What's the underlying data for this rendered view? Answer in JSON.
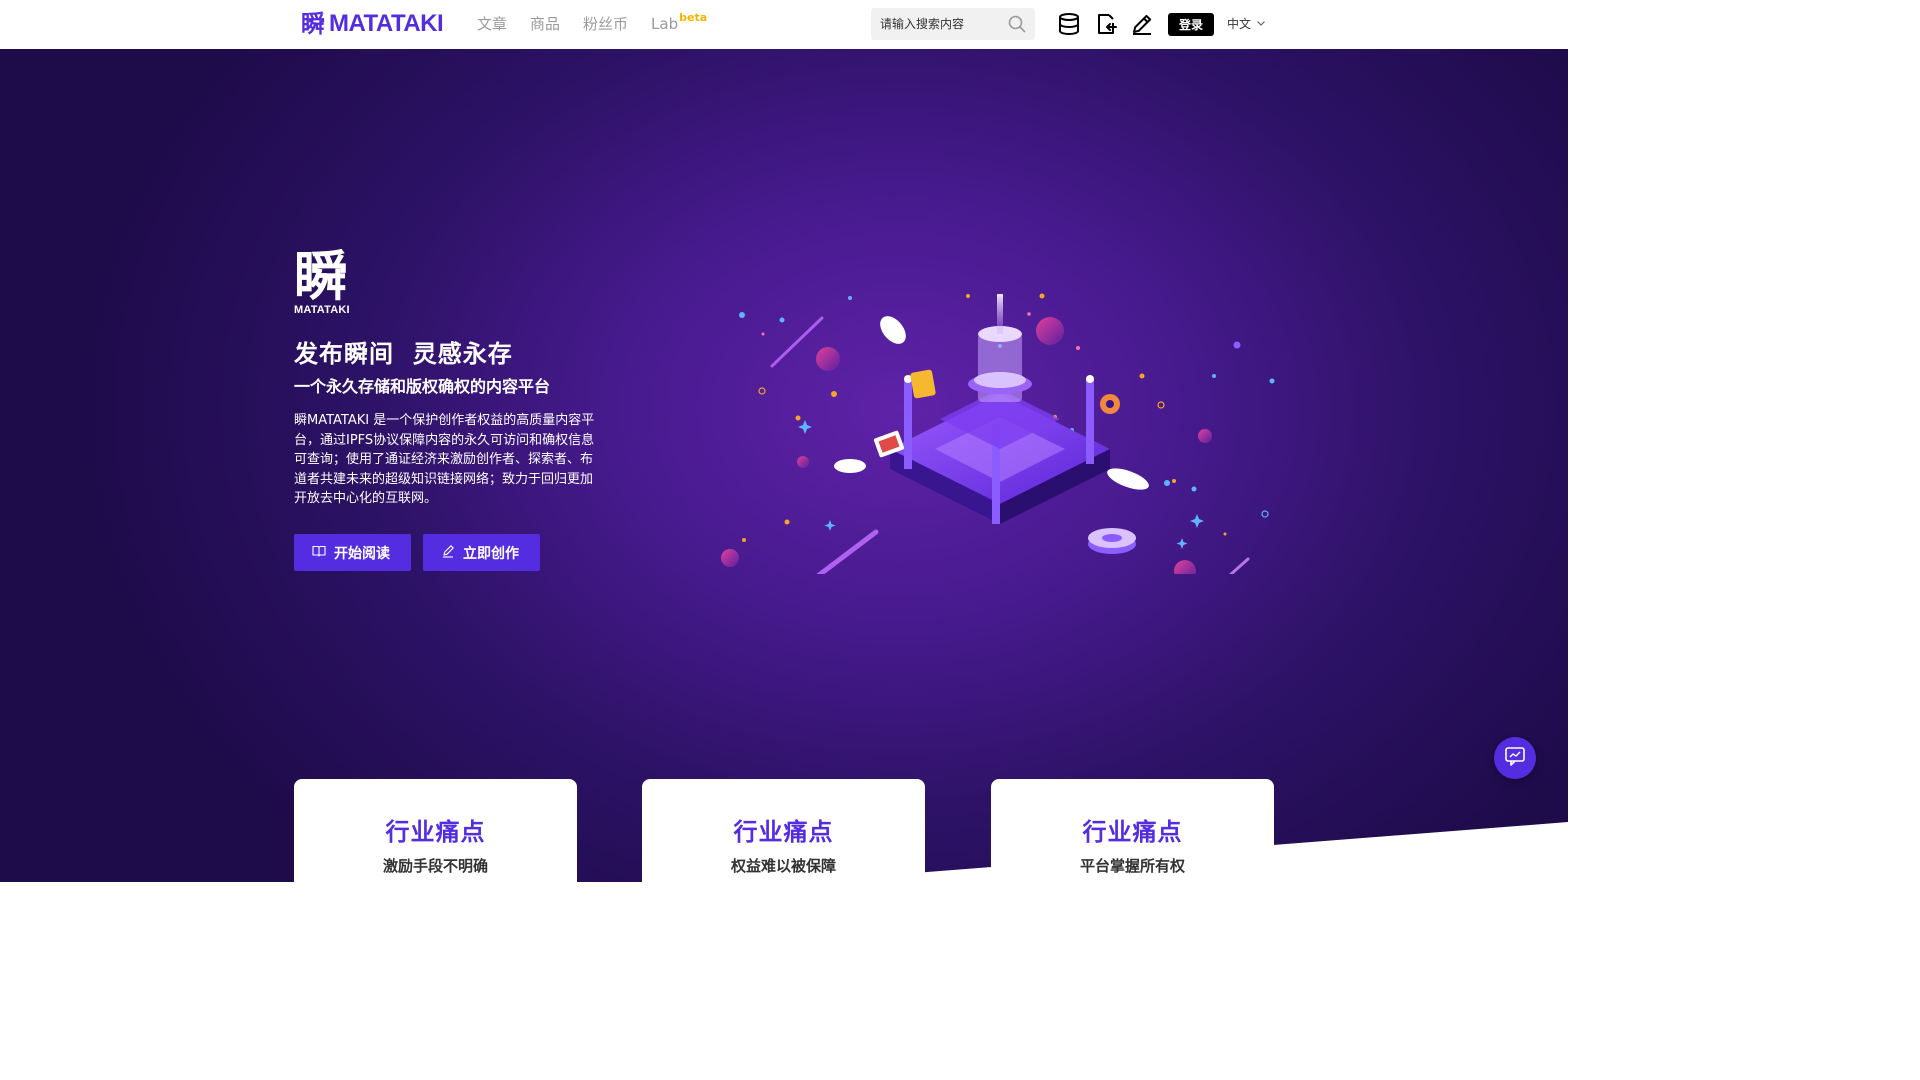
{
  "nav": {
    "logo_cn": "瞬",
    "logo_en": "MATATAKI",
    "links": [
      {
        "label": "文章"
      },
      {
        "label": "商品"
      },
      {
        "label": "粉丝币"
      },
      {
        "label": "Lab",
        "badge": "beta"
      }
    ],
    "search_placeholder": "请输入搜索内容",
    "login_label": "登录",
    "language": "中文",
    "icons": [
      "search-icon",
      "database-icon",
      "export-icon",
      "pencil-icon",
      "chevron-down-icon"
    ]
  },
  "hero": {
    "brand_cn": "瞬",
    "brand_en": "MATATAKI",
    "headline": "发布瞬间  灵感永存",
    "subhead": "一个永久存储和版权确权的内容平台",
    "description": "瞬MATATAKI 是一个保护创作者权益的高质量内容平台，通过IPFS协议保障内容的永久可访问和确权信息可查询；使用了通证经济来激励创作者、探索者、布道者共建未来的超级知识链接网络；致力于回归更加开放去中心化的互联网。",
    "buttons": [
      {
        "label": "开始阅读",
        "icon": "book-icon"
      },
      {
        "label": "立即创作",
        "icon": "pen-icon"
      }
    ]
  },
  "cards": [
    {
      "title": "行业痛点",
      "subtitle": "激励手段不明确"
    },
    {
      "title": "行业痛点",
      "subtitle": "权益难以被保障"
    },
    {
      "title": "行业痛点",
      "subtitle": "平台掌握所有权"
    }
  ],
  "colors": {
    "brand": "#542de0",
    "beta": "#f7b500",
    "hero_dark": "#1e0b4a",
    "hero_mid": "#461a8d"
  },
  "chat_icon": "chat-icon"
}
